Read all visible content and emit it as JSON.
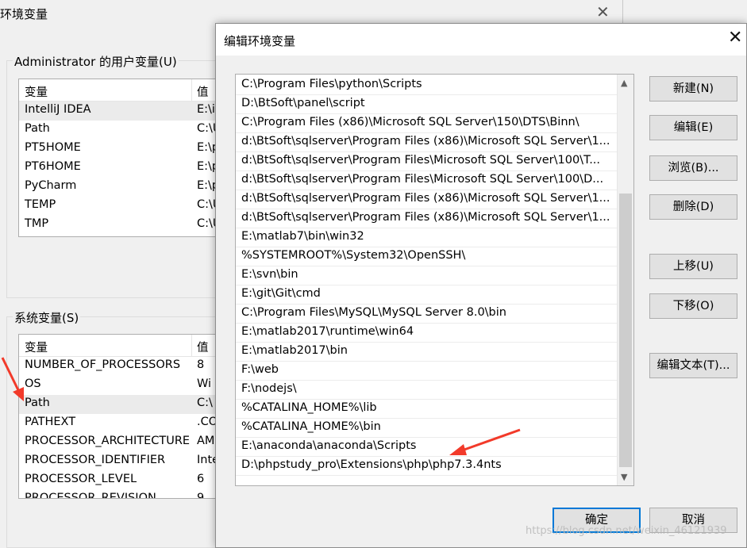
{
  "back_dialog": {
    "title": "环境变量",
    "close_glyph": "✕",
    "user_group_label": "Administrator 的用户变量(U)",
    "user_headers": [
      "变量",
      "值"
    ],
    "user_rows": [
      {
        "name": "IntelliJ IDEA",
        "value": "E:\\i"
      },
      {
        "name": "Path",
        "value": "C:\\U"
      },
      {
        "name": "PT5HOME",
        "value": "E:\\p"
      },
      {
        "name": "PT6HOME",
        "value": "E:\\p"
      },
      {
        "name": "PyCharm",
        "value": "E:\\p"
      },
      {
        "name": "TEMP",
        "value": "C:\\U"
      },
      {
        "name": "TMP",
        "value": "C:\\U"
      }
    ],
    "system_group_label": "系统变量(S)",
    "system_headers": [
      "变量",
      "值"
    ],
    "system_rows": [
      {
        "name": "NUMBER_OF_PROCESSORS",
        "value": "8"
      },
      {
        "name": "OS",
        "value": "Wi"
      },
      {
        "name": "Path",
        "value": "C:\\"
      },
      {
        "name": "PATHEXT",
        "value": ".CO"
      },
      {
        "name": "PROCESSOR_ARCHITECTURE",
        "value": "AM"
      },
      {
        "name": "PROCESSOR_IDENTIFIER",
        "value": "Inte"
      },
      {
        "name": "PROCESSOR_LEVEL",
        "value": "6"
      },
      {
        "name": "PROCESSOR_REVISION",
        "value": "9"
      }
    ]
  },
  "edit_dialog": {
    "title": "编辑环境变量",
    "close_glyph": "✕",
    "paths": [
      "C:\\Program Files\\python\\Scripts",
      "D:\\BtSoft\\panel\\script",
      "C:\\Program Files (x86)\\Microsoft SQL Server\\150\\DTS\\Binn\\",
      "d:\\BtSoft\\sqlserver\\Program Files (x86)\\Microsoft SQL Server\\1...",
      "d:\\BtSoft\\sqlserver\\Program Files\\Microsoft SQL Server\\100\\T...",
      "d:\\BtSoft\\sqlserver\\Program Files\\Microsoft SQL Server\\100\\D...",
      "d:\\BtSoft\\sqlserver\\Program Files (x86)\\Microsoft SQL Server\\1...",
      "d:\\BtSoft\\sqlserver\\Program Files (x86)\\Microsoft SQL Server\\1...",
      "E:\\matlab7\\bin\\win32",
      "%SYSTEMROOT%\\System32\\OpenSSH\\",
      "E:\\svn\\bin",
      "E:\\git\\Git\\cmd",
      "C:\\Program Files\\MySQL\\MySQL Server 8.0\\bin",
      "E:\\matlab2017\\runtime\\win64",
      "E:\\matlab2017\\bin",
      "F:\\web",
      "F:\\nodejs\\",
      "%CATALINA_HOME%\\lib",
      "%CATALINA_HOME%\\bin",
      "E:\\anaconda\\anaconda\\Scripts",
      "D:\\phpstudy_pro\\Extensions\\php\\php7.3.4nts"
    ],
    "buttons": {
      "new": "新建(N)",
      "edit": "编辑(E)",
      "browse": "浏览(B)...",
      "delete": "删除(D)",
      "move_up": "上移(U)",
      "move_down": "下移(O)",
      "edit_text": "编辑文本(T)..."
    },
    "ok": "确定",
    "cancel": "取消"
  },
  "watermark": "https://blog.csdn.net/weixin_46121939",
  "colors": {
    "accent": "#0078d7",
    "arrow": "#f23a2a"
  }
}
